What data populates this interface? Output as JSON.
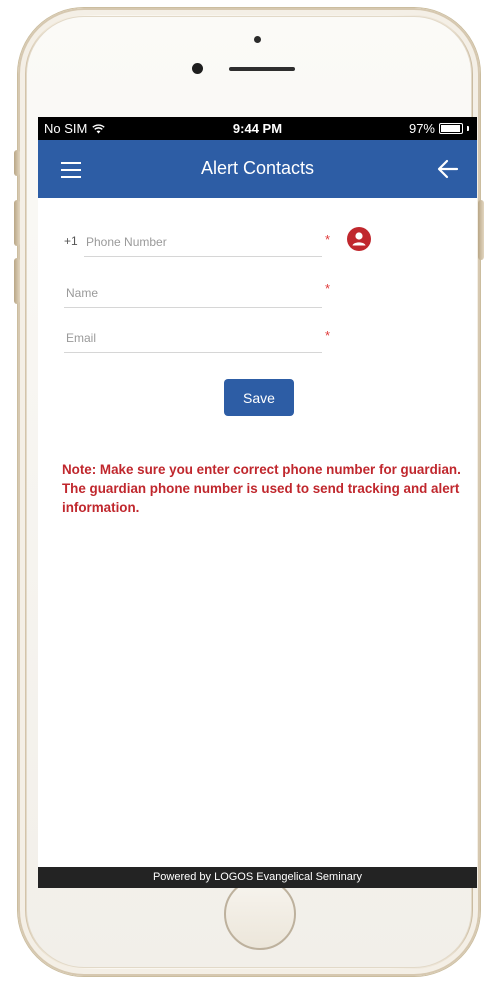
{
  "status_bar": {
    "carrier": "No SIM",
    "time": "9:44 PM",
    "battery": "97%"
  },
  "header": {
    "title": "Alert Contacts"
  },
  "form": {
    "country_code": "+1",
    "phone_placeholder": "Phone Number",
    "name_placeholder": "Name",
    "email_placeholder": "Email",
    "required_marker": "*",
    "save_label": "Save"
  },
  "note": "Note: Make sure you enter correct phone number for guardian. The guardian phone number is used to send tracking and alert information.",
  "footer": {
    "text": "Powered by LOGOS Evangelical Seminary"
  },
  "colors": {
    "accent": "#2d5da5",
    "note": "#c0272d",
    "required": "#e03a3a"
  }
}
